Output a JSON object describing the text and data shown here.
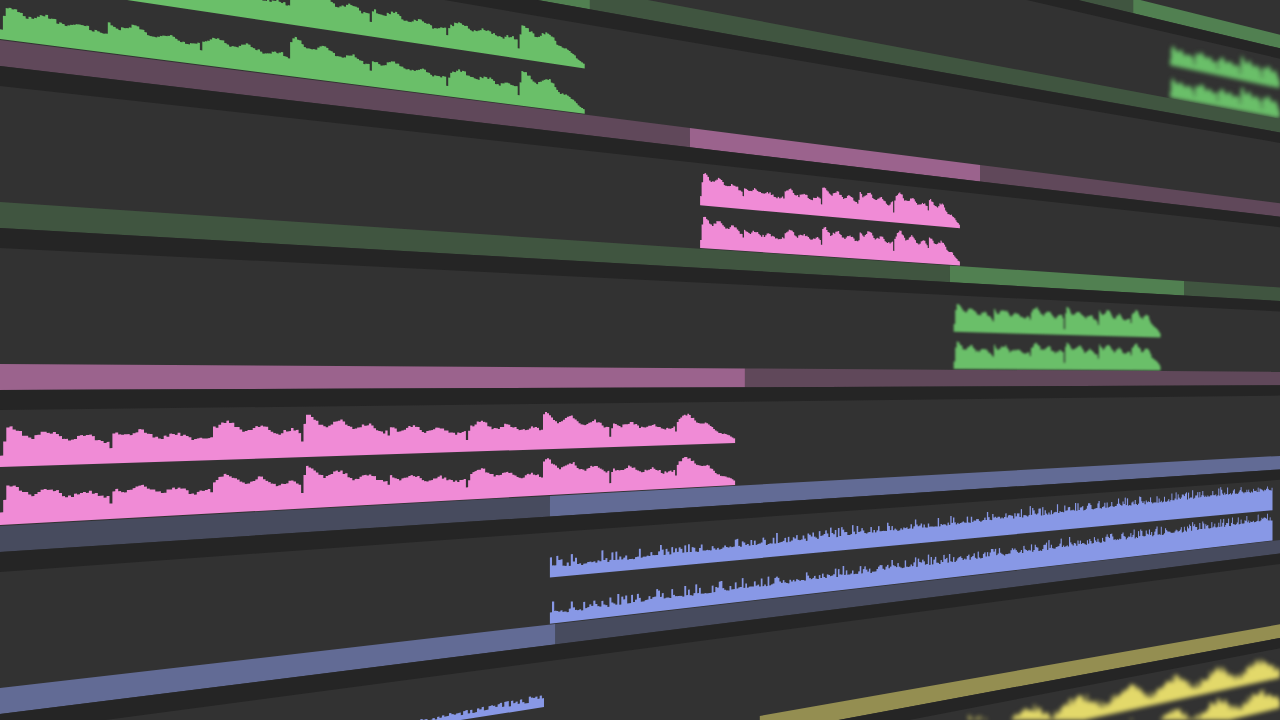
{
  "timeline": {
    "tracks": [
      {
        "color": "#6abf69"
      },
      {
        "color": "#6abf69"
      },
      {
        "color": "#f08bd6"
      },
      {
        "color": "#6abf69"
      },
      {
        "color": "#f08bd6"
      },
      {
        "color": "#8898e6"
      },
      {
        "color": "#8898e6"
      },
      {
        "color": "#e3d96a"
      }
    ]
  }
}
